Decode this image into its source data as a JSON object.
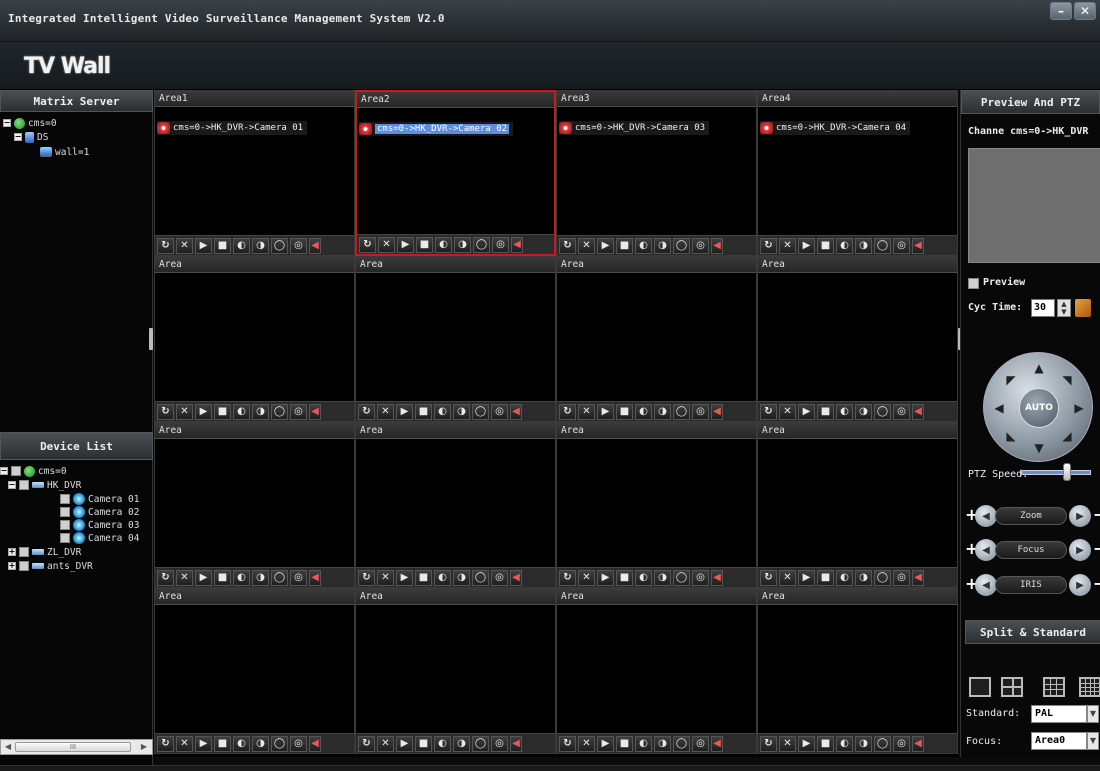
{
  "window": {
    "title": "Integrated Intelligent Video Surveillance Management System V2.0",
    "minimize": "–",
    "close": "✕"
  },
  "banner": {
    "brand": "TV Wall"
  },
  "matrix_server": {
    "header": "Matrix Server",
    "nodes": [
      {
        "toggle": "−",
        "label": "cms=0"
      },
      {
        "toggle": "−",
        "label": "DS"
      },
      {
        "toggle": "",
        "label": "wall=1"
      }
    ]
  },
  "device_list": {
    "header": "Device List",
    "nodes": [
      {
        "toggle": "−",
        "label": "cms=0"
      },
      {
        "toggle": "−",
        "label": "HK_DVR"
      },
      {
        "toggle": "",
        "label": "Camera 01"
      },
      {
        "toggle": "",
        "label": "Camera 02"
      },
      {
        "toggle": "",
        "label": "Camera 03"
      },
      {
        "toggle": "",
        "label": "Camera 04"
      },
      {
        "toggle": "+",
        "label": "ZL_DVR"
      },
      {
        "toggle": "+",
        "label": "ants_DVR"
      }
    ],
    "scroll_thumb": "III"
  },
  "grid": {
    "cells": [
      {
        "title": "Area1",
        "stream": "cms=0->HK_DVR->Camera 01"
      },
      {
        "title": "Area2",
        "stream": "cms=0->HK_DVR->Camera 02"
      },
      {
        "title": "Area3",
        "stream": "cms=0->HK_DVR->Camera 03"
      },
      {
        "title": "Area4",
        "stream": "cms=0->HK_DVR->Camera 04"
      },
      {
        "title": "Area",
        "stream": ""
      },
      {
        "title": "Area",
        "stream": ""
      },
      {
        "title": "Area",
        "stream": ""
      },
      {
        "title": "Area",
        "stream": ""
      },
      {
        "title": "Area",
        "stream": ""
      },
      {
        "title": "Area",
        "stream": ""
      },
      {
        "title": "Area",
        "stream": ""
      },
      {
        "title": "Area",
        "stream": ""
      },
      {
        "title": "Area",
        "stream": ""
      },
      {
        "title": "Area",
        "stream": ""
      },
      {
        "title": "Area",
        "stream": ""
      },
      {
        "title": "Area",
        "stream": ""
      }
    ],
    "selected_index": 1,
    "controls": [
      {
        "name": "refresh-icon",
        "glyph": "↻"
      },
      {
        "name": "close-icon",
        "glyph": "✕"
      },
      {
        "name": "play-icon",
        "glyph": "▶"
      },
      {
        "name": "stop-icon",
        "glyph": "■"
      },
      {
        "name": "focus-up-icon",
        "glyph": "◐"
      },
      {
        "name": "focus-down-icon",
        "glyph": "◑"
      },
      {
        "name": "zoom-up-icon",
        "glyph": "◯"
      },
      {
        "name": "zoom-down-icon",
        "glyph": "◎"
      },
      {
        "name": "volume-icon",
        "glyph": "◀"
      }
    ]
  },
  "right": {
    "header": "Preview And PTZ",
    "channel_label": "Channe cms=0->HK_DVR",
    "preview_label": "Preview",
    "cyc_time_label": "Cyc Time:",
    "cyc_time_value": "30",
    "ptz_auto": "AUTO",
    "ptz_speed_label": "PTZ Speed:",
    "ptz_speed_fraction": 0.65,
    "lens": [
      {
        "label": "Zoom"
      },
      {
        "label": "Focus"
      },
      {
        "label": "IRIS"
      }
    ],
    "split_header": "Split & Standard",
    "standard_label": "Standard:",
    "standard_value": "PAL",
    "focus_label": "Focus:",
    "focus_value": "Area0"
  }
}
